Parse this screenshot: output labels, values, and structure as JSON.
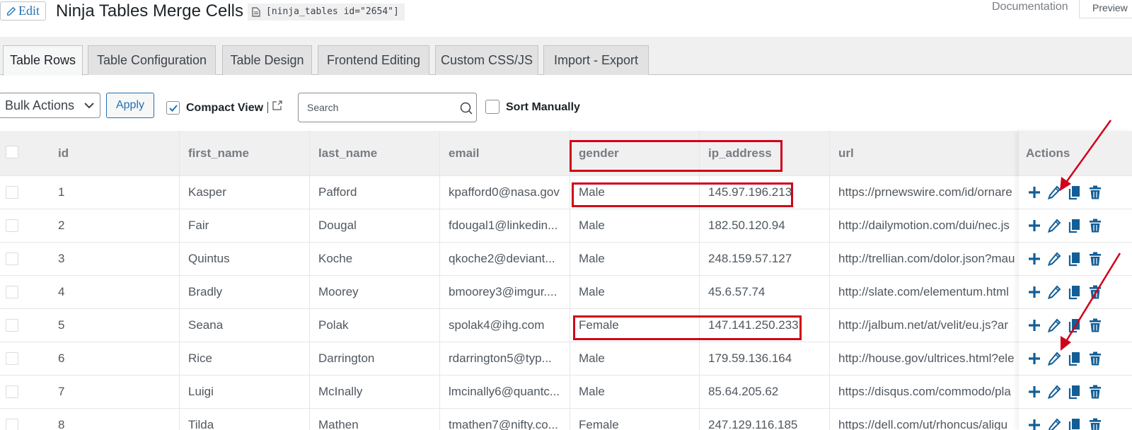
{
  "header": {
    "edit_label": "Edit",
    "title": "Ninja Tables Merge Cells",
    "shortcode": "[ninja_tables id=\"2654\"]",
    "documentation": "Documentation",
    "preview": "Preview"
  },
  "tabs": [
    {
      "label": "Table Rows",
      "active": true
    },
    {
      "label": "Table Configuration",
      "active": false
    },
    {
      "label": "Table Design",
      "active": false
    },
    {
      "label": "Frontend Editing",
      "active": false
    },
    {
      "label": "Custom CSS/JS",
      "active": false
    },
    {
      "label": "Import - Export",
      "active": false
    }
  ],
  "toolbar": {
    "bulk_actions": "Bulk Actions",
    "apply": "Apply",
    "compact_view": "Compact View",
    "compact_checked": true,
    "search_placeholder": "Search",
    "sort_manually": "Sort Manually",
    "sort_checked": false
  },
  "table": {
    "columns": [
      "id",
      "first_name",
      "last_name",
      "email",
      "gender",
      "ip_address",
      "url"
    ],
    "actions_header": "Actions",
    "rows": [
      [
        "1",
        "Kasper",
        "Pafford",
        "kpafford0@nasa.gov",
        "Male",
        "145.97.196.213",
        "https://prnewswire.com/id/ornare"
      ],
      [
        "2",
        "Fair",
        "Dougal",
        "fdougal1@linkedin...",
        "Male",
        "182.50.120.94",
        "http://dailymotion.com/dui/nec.js"
      ],
      [
        "3",
        "Quintus",
        "Koche",
        "qkoche2@deviant...",
        "Male",
        "248.159.57.127",
        "http://trellian.com/dolor.json?mau"
      ],
      [
        "4",
        "Bradly",
        "Moorey",
        "bmoorey3@imgur....",
        "Male",
        "45.6.57.74",
        "http://slate.com/elementum.html"
      ],
      [
        "5",
        "Seana",
        "Polak",
        "spolak4@ihg.com",
        "Female",
        "147.141.250.233",
        "http://jalbum.net/at/velit/eu.js?ar"
      ],
      [
        "6",
        "Rice",
        "Darrington",
        "rdarrington5@typ...",
        "Male",
        "179.59.136.164",
        "http://house.gov/ultrices.html?ele"
      ],
      [
        "7",
        "Luigi",
        "McInally",
        "lmcinally6@quantc...",
        "Male",
        "85.64.205.62",
        "https://disqus.com/commodo/pla"
      ],
      [
        "8",
        "Tilda",
        "Mathen",
        "tmathen7@nifty.co...",
        "Female",
        "247.129.116.185",
        "https://dell.com/ut/rhoncus/aligu"
      ]
    ]
  },
  "icons": {
    "add": "plus-icon",
    "edit": "pencil-icon",
    "duplicate": "copy-icon",
    "delete": "trash-icon"
  },
  "colors": {
    "accent": "#2271b1",
    "action_icons": "#135e96",
    "highlight": "#d0021b"
  }
}
